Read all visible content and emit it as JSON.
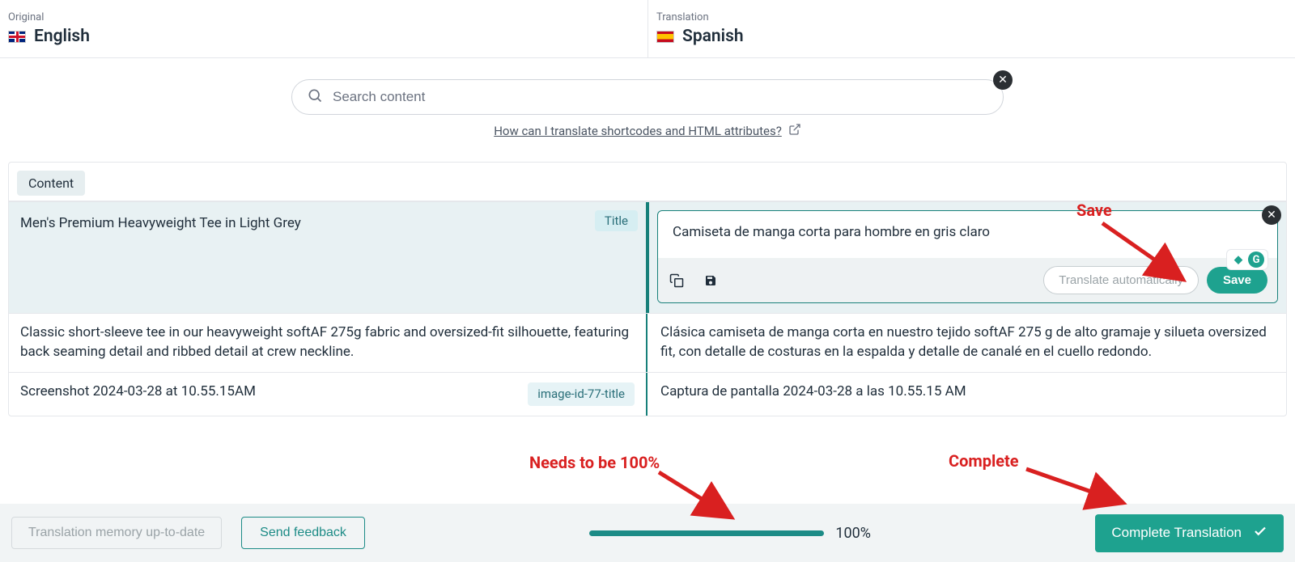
{
  "header": {
    "original_label": "Original",
    "original_lang": "English",
    "translation_label": "Translation",
    "translation_lang": "Spanish"
  },
  "search": {
    "placeholder": "Search content",
    "help_text": "How can I translate shortcodes and HTML attributes?"
  },
  "tab_label": "Content",
  "rows": [
    {
      "original": "Men's Premium Heavyweight Tee in Light Grey",
      "badge": "Title",
      "translation": "Camiseta de manga corta para hombre en gris claro",
      "auto_label": "Translate automatically",
      "save_label": "Save"
    },
    {
      "original": "Classic short-sleeve tee in our heavyweight softAF 275g fabric and oversized-fit silhouette, featuring back seaming detail and ribbed detail at crew neckline.",
      "translation": "Clásica camiseta de manga corta en nuestro tejido softAF 275 g de alto gramaje y silueta oversized fit, con detalle de costuras en la espalda y detalle de canalé en el cuello redondo."
    },
    {
      "original": "Screenshot 2024-03-28 at 10.55.15AM",
      "badge": "image-id-77-title",
      "translation": "Captura de pantalla 2024-03-28 a las 10.55.15 AM"
    }
  ],
  "footer": {
    "memory_btn": "Translation memory up-to-date",
    "feedback_btn": "Send feedback",
    "progress_pct": 100,
    "progress_text": "100%",
    "complete_btn": "Complete Translation"
  },
  "annotations": {
    "save": "Save",
    "needs": "Needs to be 100%",
    "complete": "Complete"
  }
}
